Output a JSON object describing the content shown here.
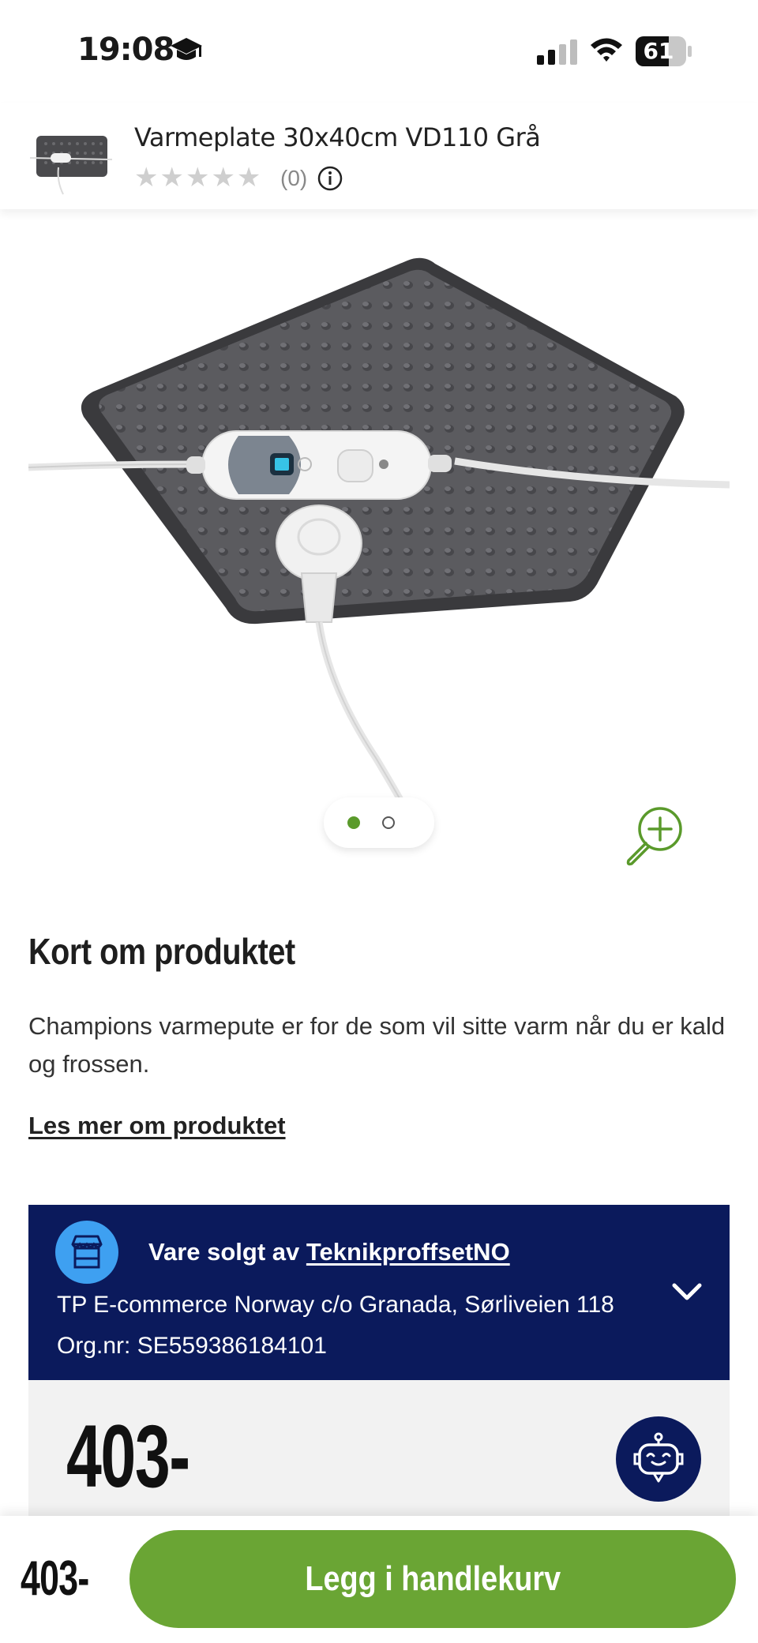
{
  "status_bar": {
    "time": "19:08",
    "battery": "61",
    "icons": [
      "graduation-cap-icon",
      "cellular-signal-icon",
      "wifi-icon",
      "battery-icon"
    ]
  },
  "product_header": {
    "title": "Varmeplate 30x40cm VD110 Grå",
    "stars": "★★★★★",
    "rating_count": "(0)",
    "rating_value": 0,
    "rating_max": 5
  },
  "gallery": {
    "image_count": 2,
    "active_index": 1,
    "zoom_icon": "zoom-in-icon"
  },
  "about": {
    "title": "Kort om produktet",
    "description": "Champions varmepute er for de som vil sitte varm når du er kald og frossen.",
    "read_more": "Les mer om produktet"
  },
  "seller": {
    "prefix": "Vare solgt av ",
    "name": "TeknikproffsetNO",
    "address": "TP E-commerce Norway c/o Granada, Sørliveien 118",
    "org": "Org.nr: SE559386184101"
  },
  "price": {
    "main": "403-",
    "bottom": "403-"
  },
  "cart": {
    "button_label": "Legg i handlekurv"
  },
  "colors": {
    "accent_green": "#6aa534",
    "seller_navy": "#0b1a5c",
    "seller_icon_blue": "#3ea0f1",
    "star_gray": "#cfcfcf"
  }
}
